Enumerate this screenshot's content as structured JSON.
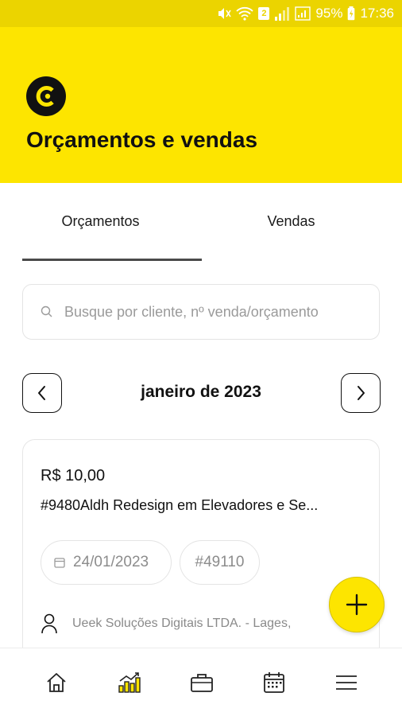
{
  "status_bar": {
    "battery": "95%",
    "time": "17:36",
    "sim_badge": "2"
  },
  "header": {
    "title": "Orçamentos e vendas"
  },
  "tabs": [
    {
      "label": "Orçamentos",
      "active": true
    },
    {
      "label": "Vendas",
      "active": false
    }
  ],
  "search": {
    "placeholder": "Busque por cliente, nº venda/orçamento",
    "value": ""
  },
  "month_nav": {
    "label": "janeiro de 2023"
  },
  "card": {
    "amount": "R$ 10,00",
    "title": "#9480Aldh Redesign em Elevadores e Se...",
    "date": "24/01/2023",
    "code": "#49110",
    "client": "Ueek Soluções Digitais LTDA. - Lages,"
  },
  "colors": {
    "brand_yellow": "#fde500",
    "status_yellow": "#ebd400"
  },
  "bottom_nav": [
    {
      "icon": "home-icon",
      "active": false
    },
    {
      "icon": "chart-icon",
      "active": true
    },
    {
      "icon": "briefcase-icon",
      "active": false
    },
    {
      "icon": "calendar-icon",
      "active": false
    },
    {
      "icon": "menu-icon",
      "active": false
    }
  ]
}
